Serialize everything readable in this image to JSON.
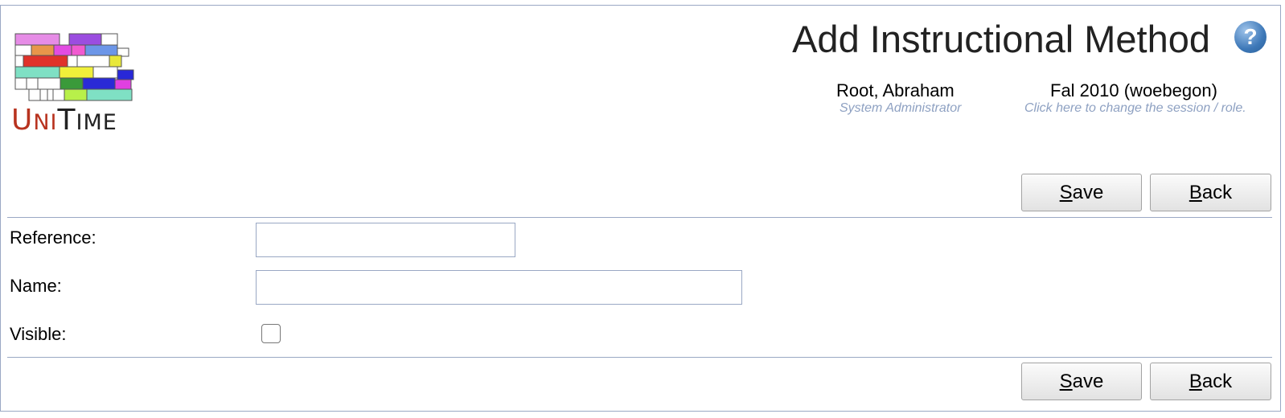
{
  "header": {
    "title": "Add Instructional Method",
    "help_icon": "help-icon",
    "logo": {
      "text_u": "U",
      "text_ni": "NI",
      "text_t": "T",
      "text_ime": "IME"
    },
    "user": {
      "name": "Root, Abraham",
      "role": "System Administrator"
    },
    "session": {
      "name": "Fal 2010 (woebegon)",
      "hint": "Click here to change the session / role."
    }
  },
  "buttons": {
    "save_mnemonic": "S",
    "save_rest": "ave",
    "back_mnemonic": "B",
    "back_rest": "ack"
  },
  "form": {
    "reference_label": "Reference:",
    "reference_value": "",
    "name_label": "Name:",
    "name_value": "",
    "visible_label": "Visible:",
    "visible_checked": false
  },
  "colors": {
    "frame_border": "#9aa8c4",
    "hint_text": "#8ea1c2",
    "help_icon": "#3d78b8"
  }
}
